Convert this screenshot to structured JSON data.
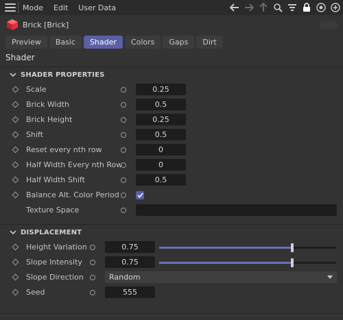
{
  "menubar": {
    "items": [
      "Mode",
      "Edit",
      "User Data"
    ]
  },
  "object": {
    "name": "Brick [Brick]",
    "icon": "brick-cube-icon",
    "icon_color": "#e0343c"
  },
  "tabs": [
    {
      "label": "Preview",
      "active": false
    },
    {
      "label": "Basic",
      "active": false
    },
    {
      "label": "Shader",
      "active": true
    },
    {
      "label": "Colors",
      "active": false
    },
    {
      "label": "Gaps",
      "active": false
    },
    {
      "label": "Dirt",
      "active": false
    }
  ],
  "section_title": "Shader",
  "shader_properties": {
    "header": "SHADER PROPERTIES",
    "rows": [
      {
        "label": "Scale",
        "value": "0.25"
      },
      {
        "label": "Brick Width",
        "value": "0.5"
      },
      {
        "label": "Brick Height",
        "value": "0.25"
      },
      {
        "label": "Shift",
        "value": "0.5"
      },
      {
        "label": "Reset every nth row",
        "value": "0"
      },
      {
        "label": "Half Width Every nth Row",
        "value": "0"
      },
      {
        "label": "Half Width Shift",
        "value": "0.5"
      },
      {
        "label": "Balance Alt. Color Period",
        "checked": true
      },
      {
        "label": "Texture Space",
        "value": ""
      }
    ]
  },
  "displacement": {
    "header": "DISPLACEMENT",
    "rows": [
      {
        "label": "Height Variation",
        "value": "0.75",
        "slider_fraction": 0.75
      },
      {
        "label": "Slope Intensity",
        "value": "0.75",
        "slider_fraction": 0.75
      },
      {
        "label": "Slope Direction",
        "value": "Random"
      },
      {
        "label": "Seed",
        "value": "555"
      }
    ]
  },
  "colors": {
    "accent": "#5a5fa6",
    "background": "#333333",
    "field": "#1d1d1d"
  }
}
